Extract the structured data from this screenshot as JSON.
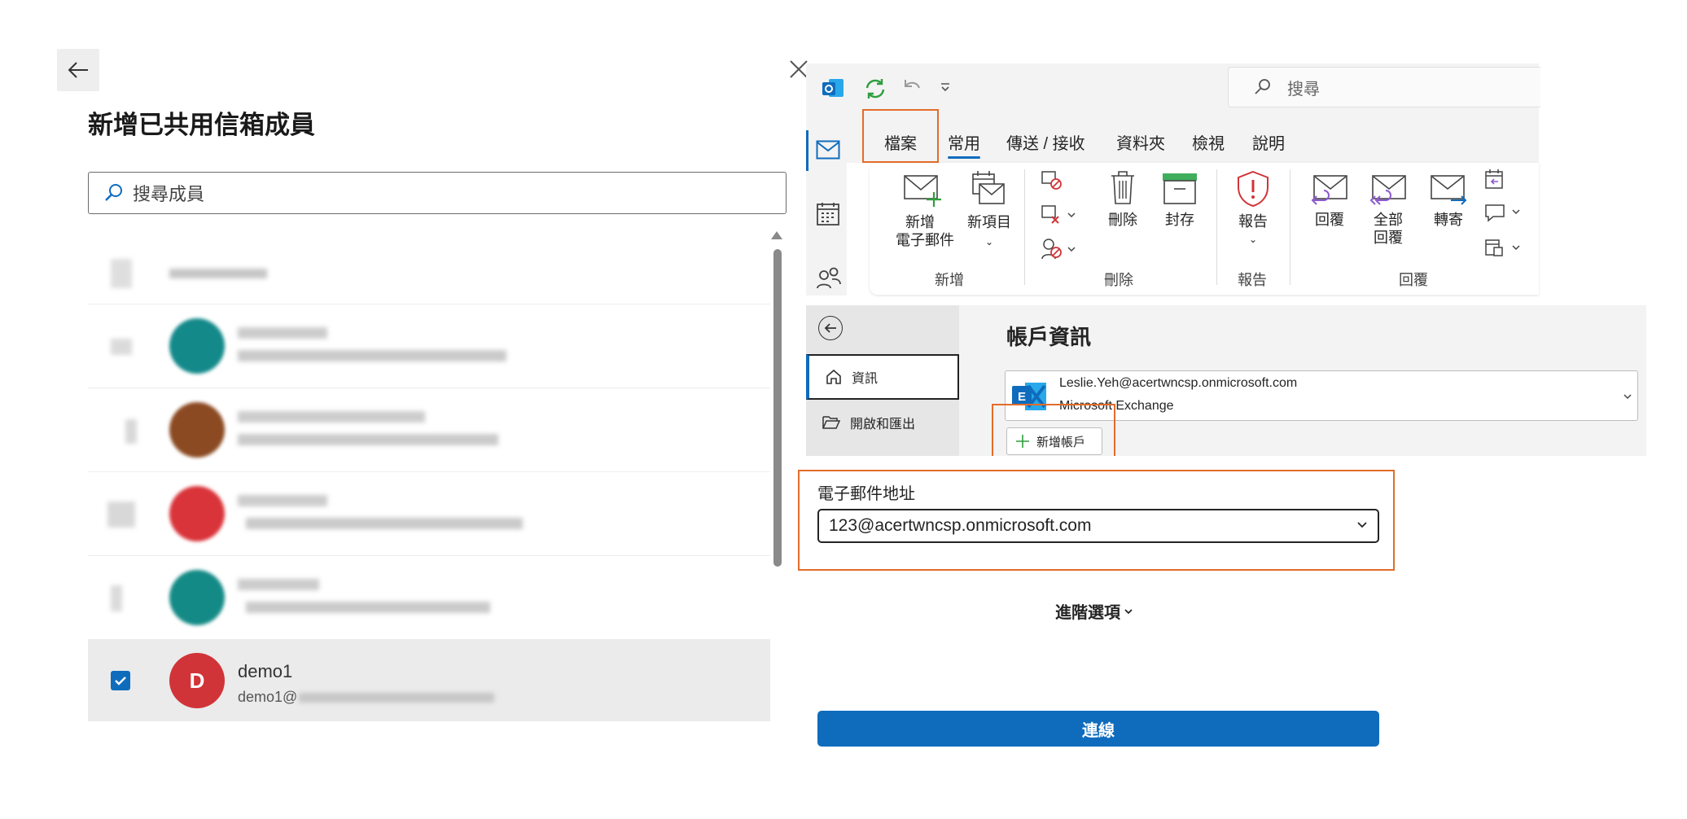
{
  "left_panel": {
    "title": "新增已共用信箱成員",
    "search_placeholder": "搜尋成員",
    "members": [
      {
        "name": "",
        "email": "",
        "selected": false,
        "avatar_color": "#cccccc"
      },
      {
        "name": "",
        "email": "",
        "selected": false,
        "avatar_color": "#14898a"
      },
      {
        "name": "",
        "email": "",
        "selected": false,
        "avatar_color": "#8b4a22"
      },
      {
        "name": "",
        "email": "",
        "selected": false,
        "avatar_color": "#d9343a"
      },
      {
        "name": "",
        "email": "",
        "selected": false,
        "avatar_color": "#148a86"
      },
      {
        "name": "demo1",
        "email": "demo1@",
        "selected": true,
        "avatar_letter": "D",
        "avatar_color": "#d13438"
      }
    ]
  },
  "outlook": {
    "search_placeholder": "搜尋",
    "menu": [
      "檔案",
      "常用",
      "傳送 / 接收",
      "資料夾",
      "檢視",
      "說明"
    ],
    "active_menu": "常用",
    "ribbon": {
      "new_email_1": "新增",
      "new_email_2": "電子郵件",
      "new_item": "新項目",
      "delete": "刪除",
      "archive": "封存",
      "report": "報告",
      "reply": "回覆",
      "reply_all_1": "全部",
      "reply_all_2": "回覆",
      "forward": "轉寄",
      "group_new": "新增",
      "group_delete": "刪除",
      "group_report": "報告",
      "group_reply": "回覆"
    },
    "backstage": {
      "title": "帳戶資訊",
      "nav_info": "資訊",
      "nav_open_export": "開啟和匯出",
      "account_email": "Leslie.Yeh@acertwncsp.onmicrosoft.com",
      "account_type": "Microsoft Exchange",
      "add_account": "新增帳戶"
    },
    "dialog": {
      "email_label": "電子郵件地址",
      "email_value": "123@acertwncsp.onmicrosoft.com",
      "advanced_options": "進階選項",
      "connect": "連線"
    }
  },
  "colors": {
    "accent": "#0f6cbd",
    "highlight": "#e36c2a",
    "checkbox": "#0f6cbd"
  }
}
